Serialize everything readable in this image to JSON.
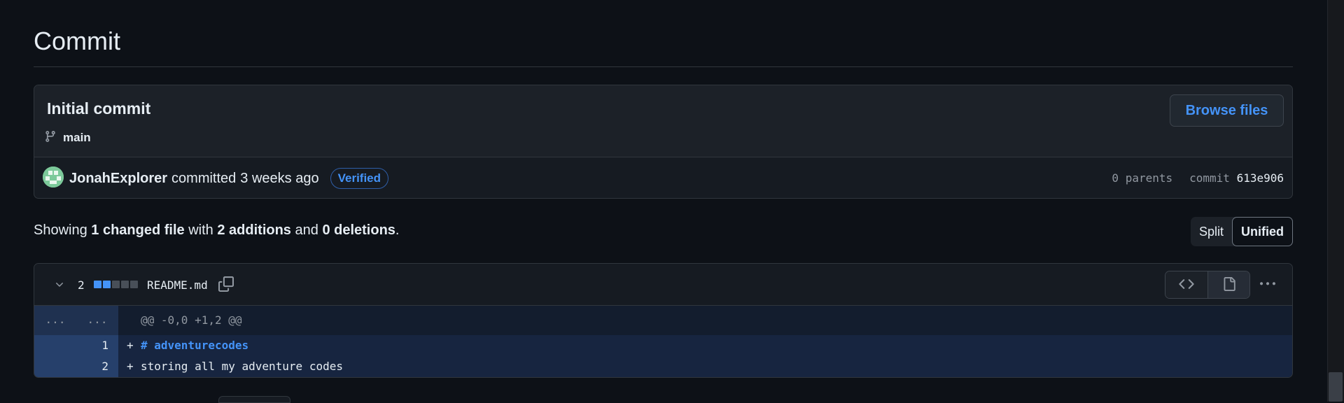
{
  "page": {
    "title": "Commit"
  },
  "commit": {
    "message": "Initial commit",
    "branch": "main",
    "browse_files_label": "Browse files",
    "author": "JonahExplorer",
    "action": "committed",
    "when": "3 weeks ago",
    "verified_label": "Verified",
    "parents_label": "0 parents",
    "commit_label": "commit",
    "sha": "613e906"
  },
  "summary": {
    "prefix": "Showing",
    "files": "1 changed file",
    "with": "with",
    "additions": "2 additions",
    "and": "and",
    "deletions": "0 deletions",
    "suffix": "."
  },
  "view_toggle": {
    "split_label": "Split",
    "unified_label": "Unified",
    "active": "Unified"
  },
  "file": {
    "changes_count": "2",
    "diffstat_blocks": [
      "added",
      "added",
      "neutral",
      "neutral",
      "neutral"
    ],
    "name": "README.md",
    "hunk": {
      "left": "...",
      "right": "...",
      "header": "@@ -0,0 +1,2 @@"
    },
    "lines": [
      {
        "old": "",
        "new": "1",
        "sign": "+",
        "text": "# adventurecodes",
        "style": "heading"
      },
      {
        "old": "",
        "new": "2",
        "sign": "+",
        "text": "storing all my adventure codes",
        "style": "plain"
      }
    ]
  },
  "colors": {
    "background": "#0d1117",
    "accent": "#4493f8",
    "added_block": "#4493f8",
    "neutral_block": "#484f58",
    "add_gutter": "#26406b",
    "add_line": "#172540"
  },
  "icons": {
    "branch": "git-branch-icon",
    "copy": "copy-icon",
    "chevron": "chevron-down-icon",
    "code": "code-icon",
    "file": "file-icon",
    "more": "kebab-horizontal-icon"
  }
}
